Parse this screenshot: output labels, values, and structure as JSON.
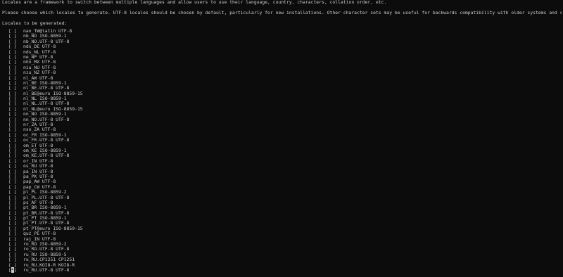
{
  "intro": {
    "line1": "Locales are a framework to switch between multiple languages and allow users to use their language, country, characters, collation order, etc.",
    "line2": "Please choose which locales to generate. UTF-8 locales should be chosen by default, particularly for new installations. Other character sets may be useful for backwards compatibility with older systems and software.",
    "line3": "Locales to be generated:"
  },
  "locales": [
    {
      "box": "[ ]",
      "name": "nan_TW@latin UTF-8"
    },
    {
      "box": "[ ]",
      "name": "nb_NO ISO-8859-1"
    },
    {
      "box": "[ ]",
      "name": "nb_NO.UTF-8 UTF-8"
    },
    {
      "box": "[ ]",
      "name": "nds_DE UTF-8"
    },
    {
      "box": "[ ]",
      "name": "nds_NL UTF-8"
    },
    {
      "box": "[ ]",
      "name": "ne_NP UTF-8"
    },
    {
      "box": "[ ]",
      "name": "nhn_MX UTF-8"
    },
    {
      "box": "[ ]",
      "name": "niu_NU UTF-8"
    },
    {
      "box": "[ ]",
      "name": "niu_NZ UTF-8"
    },
    {
      "box": "[ ]",
      "name": "nl_AW UTF-8"
    },
    {
      "box": "[ ]",
      "name": "nl_BE ISO-8859-1"
    },
    {
      "box": "[ ]",
      "name": "nl_BE.UTF-8 UTF-8"
    },
    {
      "box": "[ ]",
      "name": "nl_BE@euro ISO-8859-15"
    },
    {
      "box": "[ ]",
      "name": "nl_NL ISO-8859-1"
    },
    {
      "box": "[ ]",
      "name": "nl_NL.UTF-8 UTF-8"
    },
    {
      "box": "[ ]",
      "name": "nl_NL@euro ISO-8859-15"
    },
    {
      "box": "[ ]",
      "name": "nn_NO ISO-8859-1"
    },
    {
      "box": "[ ]",
      "name": "nn_NO.UTF-8 UTF-8"
    },
    {
      "box": "[ ]",
      "name": "nr_ZA UTF-8"
    },
    {
      "box": "[ ]",
      "name": "nso_ZA UTF-8"
    },
    {
      "box": "[ ]",
      "name": "oc_FR ISO-8859-1"
    },
    {
      "box": "[ ]",
      "name": "oc_FR.UTF-8 UTF-8"
    },
    {
      "box": "[ ]",
      "name": "om_ET UTF-8"
    },
    {
      "box": "[ ]",
      "name": "om_KE ISO-8859-1"
    },
    {
      "box": "[ ]",
      "name": "om_KE.UTF-8 UTF-8"
    },
    {
      "box": "[ ]",
      "name": "or_IN UTF-8"
    },
    {
      "box": "[ ]",
      "name": "os_RU UTF-8"
    },
    {
      "box": "[ ]",
      "name": "pa_IN UTF-8"
    },
    {
      "box": "[ ]",
      "name": "pa_PK UTF-8"
    },
    {
      "box": "[ ]",
      "name": "pap_AW UTF-8"
    },
    {
      "box": "[ ]",
      "name": "pap_CW UTF-8"
    },
    {
      "box": "[ ]",
      "name": "pl_PL ISO-8859-2"
    },
    {
      "box": "[ ]",
      "name": "pl_PL.UTF-8 UTF-8"
    },
    {
      "box": "[ ]",
      "name": "ps_AF UTF-8"
    },
    {
      "box": "[ ]",
      "name": "pt_BR ISO-8859-1"
    },
    {
      "box": "[ ]",
      "name": "pt_BR.UTF-8 UTF-8"
    },
    {
      "box": "[ ]",
      "name": "pt_PT ISO-8859-1"
    },
    {
      "box": "[ ]",
      "name": "pt_PT.UTF-8 UTF-8"
    },
    {
      "box": "[ ]",
      "name": "pt_PT@euro ISO-8859-15"
    },
    {
      "box": "[ ]",
      "name": "quz_PE UTF-8"
    },
    {
      "box": "[ ]",
      "name": "raj_IN UTF-8"
    },
    {
      "box": "[ ]",
      "name": "ro_RO ISO-8859-2"
    },
    {
      "box": "[ ]",
      "name": "ro_RO.UTF-8 UTF-8"
    },
    {
      "box": "[ ]",
      "name": "ru_RU ISO-8859-5"
    },
    {
      "box": "[ ]",
      "name": "ru_RU.CP1251 CP1251"
    },
    {
      "box": "[ ]",
      "name": "ru_RU.KOI8-R KOI8-R"
    },
    {
      "box": "[*]",
      "name": "ru_RU.UTF-8 UTF-8",
      "cursor": true
    }
  ],
  "colors": {
    "background": "#0c0c0c",
    "text": "#cccccc"
  }
}
